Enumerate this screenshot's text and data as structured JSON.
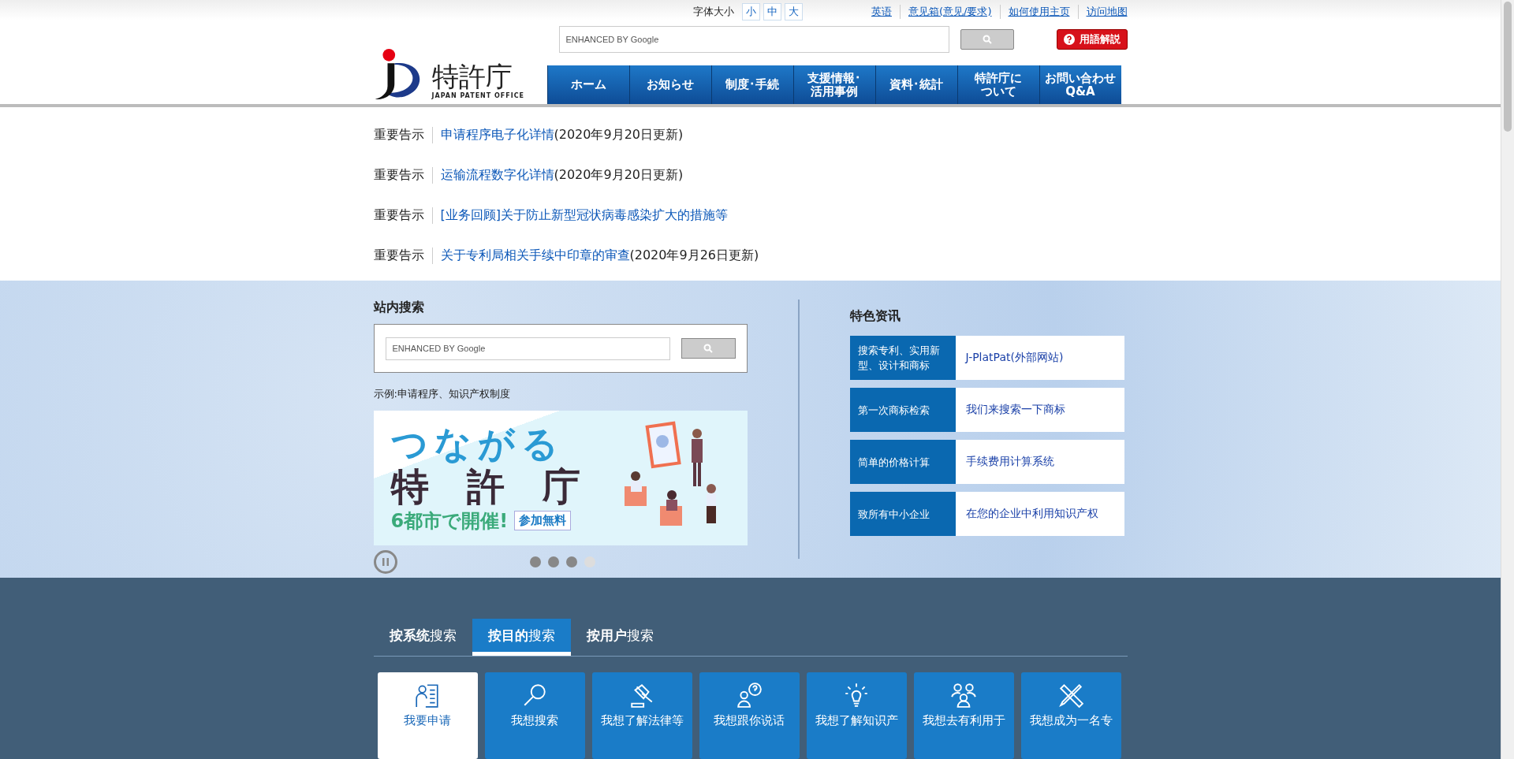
{
  "header": {
    "logo": {
      "name": "特許庁",
      "subtitle": "JAPAN PATENT OFFICE"
    },
    "font_size": {
      "label": "字体大小",
      "options": [
        {
          "label": "小",
          "selected": false
        },
        {
          "label": "中",
          "selected": false
        },
        {
          "label": "大",
          "selected": false
        }
      ]
    },
    "links": [
      "英语",
      "意见箱(意见/要求)",
      "如何使用主页",
      "访问地图"
    ],
    "search": {
      "placeholder": "ENHANCED BY Google"
    },
    "glossary_button": "用語解説",
    "nav": [
      {
        "lines": [
          "ホーム"
        ]
      },
      {
        "lines": [
          "お知らせ"
        ]
      },
      {
        "lines": [
          "制度･手続"
        ]
      },
      {
        "lines": [
          "支援情報･",
          "活用事例"
        ]
      },
      {
        "lines": [
          "資料･統計"
        ]
      },
      {
        "lines": [
          "特許庁に",
          "ついて"
        ]
      },
      {
        "lines": [
          "お問い合わせ",
          "Q&A"
        ]
      }
    ]
  },
  "notices": [
    {
      "tag": "重要告示",
      "link": "申请程序电子化详情",
      "suffix": "(2020年9月20日更新)"
    },
    {
      "tag": "重要告示",
      "link": "运输流程数字化详情",
      "suffix": "(2020年9月20日更新)"
    },
    {
      "tag": "重要告示",
      "link": "[业务回顾]关于防止新型冠状病毒感染扩大的措施等"
    },
    {
      "tag": "重要告示",
      "link": "关于专利局相关手续中印章的审查",
      "suffix": "(2020年9月26日更新)"
    }
  ],
  "site_search": {
    "title": "站内搜索",
    "placeholder": "ENHANCED BY Google",
    "example": "示例:申请程序、知识产权制度"
  },
  "banner": {
    "headline": "つながる",
    "title": "特　許　庁",
    "subline": "6都市で開催!",
    "badge": "参加無料",
    "dots": [
      {
        "selected": false
      },
      {
        "selected": false
      },
      {
        "selected": false
      },
      {
        "selected": true
      }
    ]
  },
  "featured": {
    "title": "特色资讯",
    "items": [
      {
        "label": "搜索专利、实用新型、设计和商标",
        "link": "J-PlatPat(外部网站)"
      },
      {
        "label": "第一次商标检索",
        "link": "我们来搜索一下商标"
      },
      {
        "label": "简单的价格计算",
        "link": "手续费用计算系统"
      },
      {
        "label": "致所有中小企业",
        "link": "在您的企业中利用知识产权"
      }
    ]
  },
  "search_tabs": [
    {
      "label": "**按系统**搜索",
      "selected": false
    },
    {
      "label": "**按目的**搜索",
      "selected": true
    },
    {
      "label": "**按用户**搜索",
      "selected": false
    }
  ],
  "purpose_tiles": [
    {
      "kind": "apply",
      "label": "我要申请",
      "selected": true
    },
    {
      "kind": "search",
      "label": "我想搜索",
      "selected": false
    },
    {
      "kind": "law",
      "label": "我想了解法律等",
      "selected": false
    },
    {
      "kind": "talk",
      "label": "我想跟你说话",
      "selected": false
    },
    {
      "kind": "idea",
      "label": "我想了解知识产",
      "selected": false
    },
    {
      "kind": "people",
      "label": "我想去有利用于",
      "selected": false
    },
    {
      "kind": "tools",
      "label": "我想成为一名专",
      "selected": false
    }
  ]
}
